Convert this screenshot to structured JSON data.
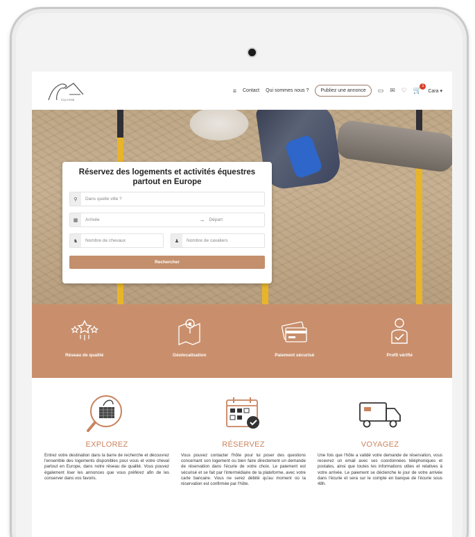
{
  "header": {
    "logo_alt": "cheval logo",
    "nav": {
      "contact": "Contact",
      "about": "Qui sommes nous ?",
      "publish": "Publiez une annonce",
      "lang": "Cara ▾"
    },
    "cart_count": "1"
  },
  "search": {
    "title": "Réservez des logements et activités équestres partout en Europe",
    "city_placeholder": "Dans quelle ville ?",
    "arrival": "Arrivée",
    "departure": "Départ",
    "horses_placeholder": "Nombre de chevaux",
    "riders_placeholder": "Nombre de cavaliers",
    "button": "Rechercher"
  },
  "features": [
    {
      "label": "Réseau de qualité",
      "icon": "stars-icon"
    },
    {
      "label": "Géolocalisation",
      "icon": "map-pin-icon"
    },
    {
      "label": "Paiement sécurisé",
      "icon": "credit-card-icon"
    },
    {
      "label": "Profil vérifié",
      "icon": "verified-user-icon"
    }
  ],
  "steps": [
    {
      "title": "EXPLOREZ",
      "icon": "magnifier-icon",
      "text": "Entrez votre destination dans la barre de recherche et découvrez l'ensemble des logements disponibles pour vous et votre cheval partout en Europe, dans notre réseau de qualité. Vous pouvez également liser les annonces que vous préférez afin de les conserver dans vos favoris."
    },
    {
      "title": "RÉSERVEZ",
      "icon": "calendar-icon",
      "text": "Vous pouvez contacter l'hôte pour lui poser des questions concernant son logement ou bien faire directement un demande de réservation dans l'écurie de votre choix. Le paiement est sécurisé et se fait par l'intermédiaire de la plateforme, avec votre carte bancaire. Vous ne serez débité qu'au moment où la réservation est confirmée par l'hôte."
    },
    {
      "title": "VOYAGEZ",
      "icon": "horse-truck-icon",
      "text": "Une fois que l'hôte a validé votre demande de réservation, vous recevrez un email avec ses coordonnées téléphoniques et postales, ainsi que toutes les informations utiles et relatives à votre arrivée. Le paiement se déclenche le jour de votre arrivée dans l'écurie et sera sur le compte en banque de l'écurie sous 48h."
    }
  ],
  "colors": {
    "accent": "#c98f6c",
    "step_title": "#c9845e",
    "cart": "#d6402a"
  }
}
